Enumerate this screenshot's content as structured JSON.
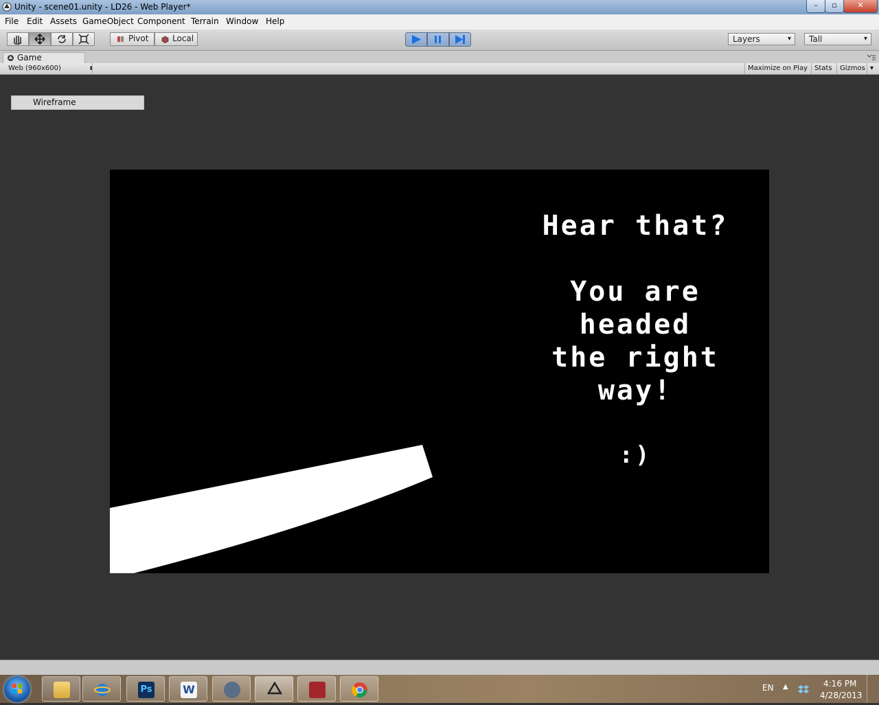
{
  "window": {
    "title": "Unity - scene01.unity - LD26 - Web Player*",
    "minimize": "–",
    "maximize": "▫",
    "close": "✕"
  },
  "menu": [
    "File",
    "Edit",
    "Assets",
    "GameObject",
    "Component",
    "Terrain",
    "Window",
    "Help"
  ],
  "toolbar": {
    "pivot_label": "Pivot",
    "local_label": "Local",
    "layers_label": "Layers",
    "layout_label": "Tall"
  },
  "game_tab": {
    "label": "Game",
    "resolution": "Web (960x600)",
    "maximize_on_play": "Maximize on Play",
    "stats": "Stats",
    "gizmos": "Gizmos"
  },
  "render_mode": "Wireframe",
  "game": {
    "line1": "Hear that?",
    "line2": "You are\nheaded\nthe right\nway!",
    "line3": ":)"
  },
  "tray": {
    "language": "EN",
    "time": "4:16 PM",
    "date": "4/28/2013"
  },
  "colors": {
    "play_active": "#1a6fe0",
    "canvas": "#000000",
    "viewport": "#333333"
  }
}
